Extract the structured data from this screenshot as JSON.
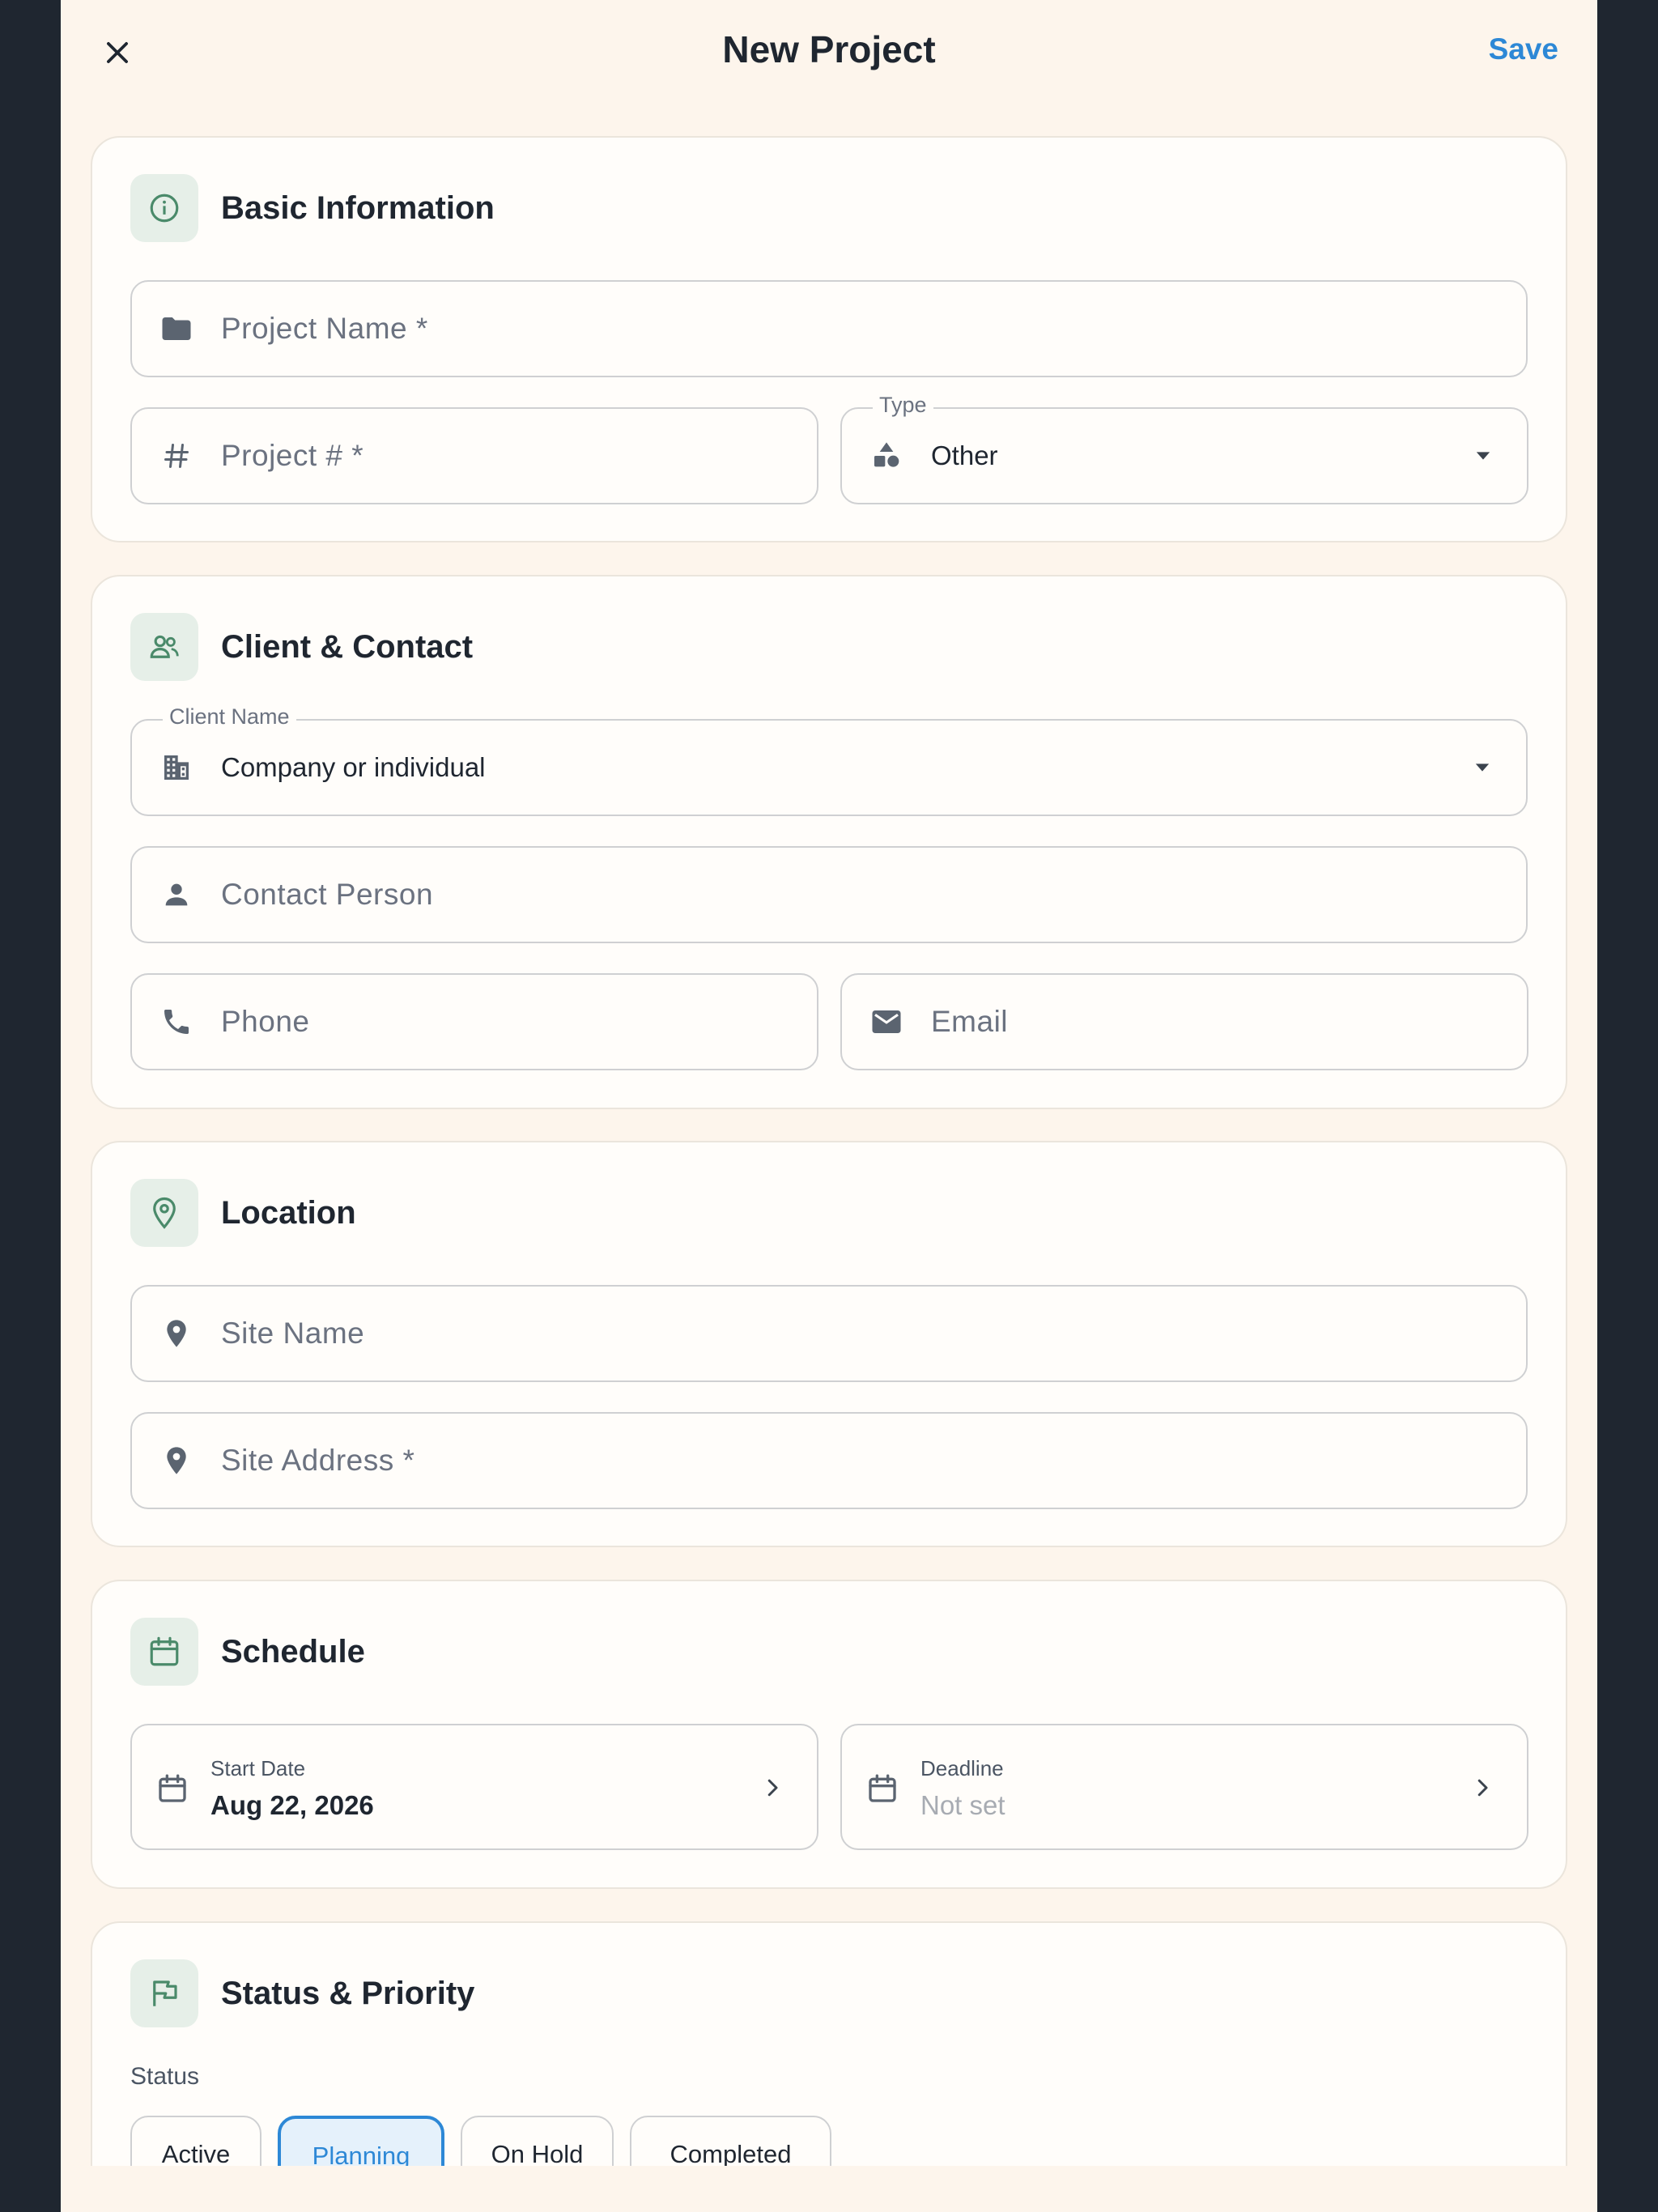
{
  "header": {
    "title": "New Project",
    "save_label": "Save",
    "close_icon": "close-icon"
  },
  "colors": {
    "accent": "#2d88d6",
    "section_icon": "#4a8a6a",
    "background": "#fdf5ec"
  },
  "basic": {
    "title": "Basic Information",
    "project_name_placeholder": "Project Name *",
    "project_number_placeholder": "Project # *",
    "type_label": "Type",
    "type_value": "Other"
  },
  "client": {
    "title": "Client & Contact",
    "client_name_label": "Client Name",
    "client_name_value": "Company or individual",
    "contact_placeholder": "Contact Person",
    "phone_placeholder": "Phone",
    "email_placeholder": "Email"
  },
  "location": {
    "title": "Location",
    "site_name_placeholder": "Site Name",
    "site_address_placeholder": "Site Address *"
  },
  "schedule": {
    "title": "Schedule",
    "start_label": "Start Date",
    "start_value": "Aug 22, 2026",
    "deadline_label": "Deadline",
    "deadline_value": "Not set"
  },
  "status": {
    "title": "Status & Priority",
    "status_label": "Status",
    "options": [
      "Active",
      "Planning",
      "On Hold",
      "Completed"
    ],
    "selected": "Planning"
  }
}
